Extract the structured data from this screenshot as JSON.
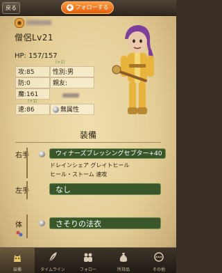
{
  "header": {
    "back_label": "戻る",
    "follow_label": "フォローする"
  },
  "profile": {
    "job_level": "僧侶Lv21",
    "hp": "HP: 157/157",
    "hp_bonus": "(+2)"
  },
  "stats": {
    "attack": "攻:85",
    "gender": "性別:男",
    "defense": "防:0",
    "friend": "親友:",
    "magic": "魔:161",
    "magic_bonus": "(+1)",
    "speed": "速:86",
    "element": "無属性"
  },
  "equipment": {
    "title": "装備",
    "right_label": "右手",
    "right_item": "ウィナーズブレッシングセプター+40",
    "right_skills_line1": "ドレインシェア グレイトヒール",
    "right_skills_line2": "ヒール・ストーム 速攻",
    "left_label": "左手",
    "left_item": "なし",
    "body_label": "体",
    "body_item": "さそりの法衣"
  },
  "tabs": [
    {
      "label": "装備",
      "icon": "cat-icon"
    },
    {
      "label": "タイムライン",
      "icon": "feather-icon"
    },
    {
      "label": "フォロー",
      "icon": "people-icon"
    },
    {
      "label": "所持品",
      "icon": "bag-icon"
    },
    {
      "label": "その他",
      "icon": "more-icon"
    }
  ],
  "colors": {
    "follow_button": "#e35f0a",
    "item_bar": "#39572a",
    "parchment": "#e3cd96"
  }
}
